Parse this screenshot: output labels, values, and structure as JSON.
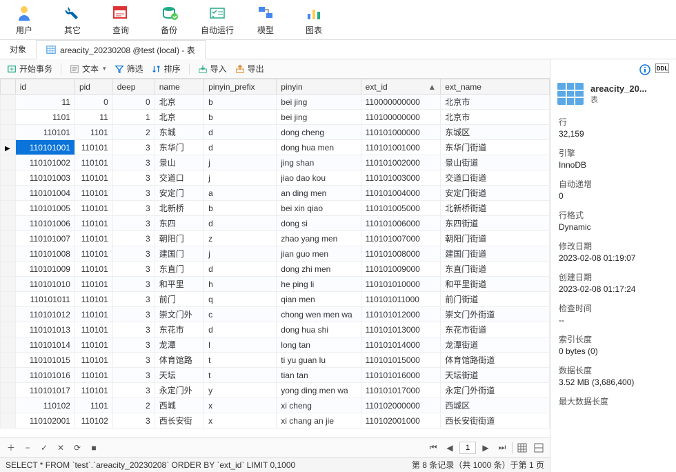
{
  "toolbar": [
    {
      "label": "用户",
      "icon": "user"
    },
    {
      "label": "其它",
      "icon": "wrench"
    },
    {
      "label": "查询",
      "icon": "query"
    },
    {
      "label": "备份",
      "icon": "backup"
    },
    {
      "label": "自动运行",
      "icon": "auto"
    },
    {
      "label": "模型",
      "icon": "model"
    },
    {
      "label": "图表",
      "icon": "chart"
    }
  ],
  "tabs": {
    "object": "对象",
    "active": "areacity_20230208 @test (local) - 表"
  },
  "actions": {
    "begin": "开始事务",
    "text": "文本",
    "filter": "筛选",
    "sort": "排序",
    "import": "导入",
    "export": "导出"
  },
  "columns": [
    "id",
    "pid",
    "deep",
    "name",
    "pinyin_prefix",
    "pinyin",
    "ext_id",
    "ext_name"
  ],
  "sort_col": "ext_id",
  "rows": [
    {
      "id": "11",
      "pid": "0",
      "deep": "0",
      "name": "北京",
      "pp": "b",
      "py": "bei jing",
      "ext": "110000000000",
      "extn": "北京市"
    },
    {
      "id": "1101",
      "pid": "11",
      "deep": "1",
      "name": "北京",
      "pp": "b",
      "py": "bei jing",
      "ext": "110100000000",
      "extn": "北京市"
    },
    {
      "id": "110101",
      "pid": "1101",
      "deep": "2",
      "name": "东城",
      "pp": "d",
      "py": "dong cheng",
      "ext": "110101000000",
      "extn": "东城区"
    },
    {
      "id": "110101001",
      "pid": "110101",
      "deep": "3",
      "name": "东华门",
      "pp": "d",
      "py": "dong hua men",
      "ext": "110101001000",
      "extn": "东华门街道",
      "sel": true,
      "mark": true
    },
    {
      "id": "110101002",
      "pid": "110101",
      "deep": "3",
      "name": "景山",
      "pp": "j",
      "py": "jing shan",
      "ext": "110101002000",
      "extn": "景山街道"
    },
    {
      "id": "110101003",
      "pid": "110101",
      "deep": "3",
      "name": "交道口",
      "pp": "j",
      "py": "jiao dao kou",
      "ext": "110101003000",
      "extn": "交道口街道"
    },
    {
      "id": "110101004",
      "pid": "110101",
      "deep": "3",
      "name": "安定门",
      "pp": "a",
      "py": "an ding men",
      "ext": "110101004000",
      "extn": "安定门街道"
    },
    {
      "id": "110101005",
      "pid": "110101",
      "deep": "3",
      "name": "北新桥",
      "pp": "b",
      "py": "bei xin qiao",
      "ext": "110101005000",
      "extn": "北新桥街道"
    },
    {
      "id": "110101006",
      "pid": "110101",
      "deep": "3",
      "name": "东四",
      "pp": "d",
      "py": "dong si",
      "ext": "110101006000",
      "extn": "东四街道"
    },
    {
      "id": "110101007",
      "pid": "110101",
      "deep": "3",
      "name": "朝阳门",
      "pp": "z",
      "py": "zhao yang men",
      "ext": "110101007000",
      "extn": "朝阳门街道"
    },
    {
      "id": "110101008",
      "pid": "110101",
      "deep": "3",
      "name": "建国门",
      "pp": "j",
      "py": "jian guo men",
      "ext": "110101008000",
      "extn": "建国门街道"
    },
    {
      "id": "110101009",
      "pid": "110101",
      "deep": "3",
      "name": "东直门",
      "pp": "d",
      "py": "dong zhi men",
      "ext": "110101009000",
      "extn": "东直门街道"
    },
    {
      "id": "110101010",
      "pid": "110101",
      "deep": "3",
      "name": "和平里",
      "pp": "h",
      "py": "he ping li",
      "ext": "110101010000",
      "extn": "和平里街道"
    },
    {
      "id": "110101011",
      "pid": "110101",
      "deep": "3",
      "name": "前门",
      "pp": "q",
      "py": "qian men",
      "ext": "110101011000",
      "extn": "前门街道"
    },
    {
      "id": "110101012",
      "pid": "110101",
      "deep": "3",
      "name": "崇文门外",
      "pp": "c",
      "py": "chong wen men wa",
      "ext": "110101012000",
      "extn": "崇文门外街道"
    },
    {
      "id": "110101013",
      "pid": "110101",
      "deep": "3",
      "name": "东花市",
      "pp": "d",
      "py": "dong hua shi",
      "ext": "110101013000",
      "extn": "东花市街道"
    },
    {
      "id": "110101014",
      "pid": "110101",
      "deep": "3",
      "name": "龙潭",
      "pp": "l",
      "py": "long tan",
      "ext": "110101014000",
      "extn": "龙潭街道"
    },
    {
      "id": "110101015",
      "pid": "110101",
      "deep": "3",
      "name": "体育馆路",
      "pp": "t",
      "py": "ti yu guan lu",
      "ext": "110101015000",
      "extn": "体育馆路街道"
    },
    {
      "id": "110101016",
      "pid": "110101",
      "deep": "3",
      "name": "天坛",
      "pp": "t",
      "py": "tian tan",
      "ext": "110101016000",
      "extn": "天坛街道"
    },
    {
      "id": "110101017",
      "pid": "110101",
      "deep": "3",
      "name": "永定门外",
      "pp": "y",
      "py": "yong ding men wa",
      "ext": "110101017000",
      "extn": "永定门外街道"
    },
    {
      "id": "110102",
      "pid": "1101",
      "deep": "2",
      "name": "西城",
      "pp": "x",
      "py": "xi cheng",
      "ext": "110102000000",
      "extn": "西城区"
    },
    {
      "id": "110102001",
      "pid": "110102",
      "deep": "3",
      "name": "西长安街",
      "pp": "x",
      "py": "xi chang an jie",
      "ext": "110102001000",
      "extn": "西长安街街道"
    }
  ],
  "pager": {
    "page": "1"
  },
  "sql": "SELECT * FROM `test`.`areacity_20230208` ORDER BY `ext_id`  LIMIT 0,1000",
  "status": "第 8 条记录（共 1000 条）于第 1 页",
  "right": {
    "title": "areacity_20...",
    "sub": "表",
    "fields": [
      {
        "l": "行",
        "v": "32,159"
      },
      {
        "l": "引擎",
        "v": "InnoDB"
      },
      {
        "l": "自动递增",
        "v": "0"
      },
      {
        "l": "行格式",
        "v": "Dynamic"
      },
      {
        "l": "修改日期",
        "v": "2023-02-08 01:19:07"
      },
      {
        "l": "创建日期",
        "v": "2023-02-08 01:17:24"
      },
      {
        "l": "检查时间",
        "v": "--"
      },
      {
        "l": "索引长度",
        "v": "0 bytes (0)"
      },
      {
        "l": "数据长度",
        "v": "3.52 MB (3,686,400)"
      },
      {
        "l": "最大数据长度",
        "v": ""
      }
    ]
  }
}
